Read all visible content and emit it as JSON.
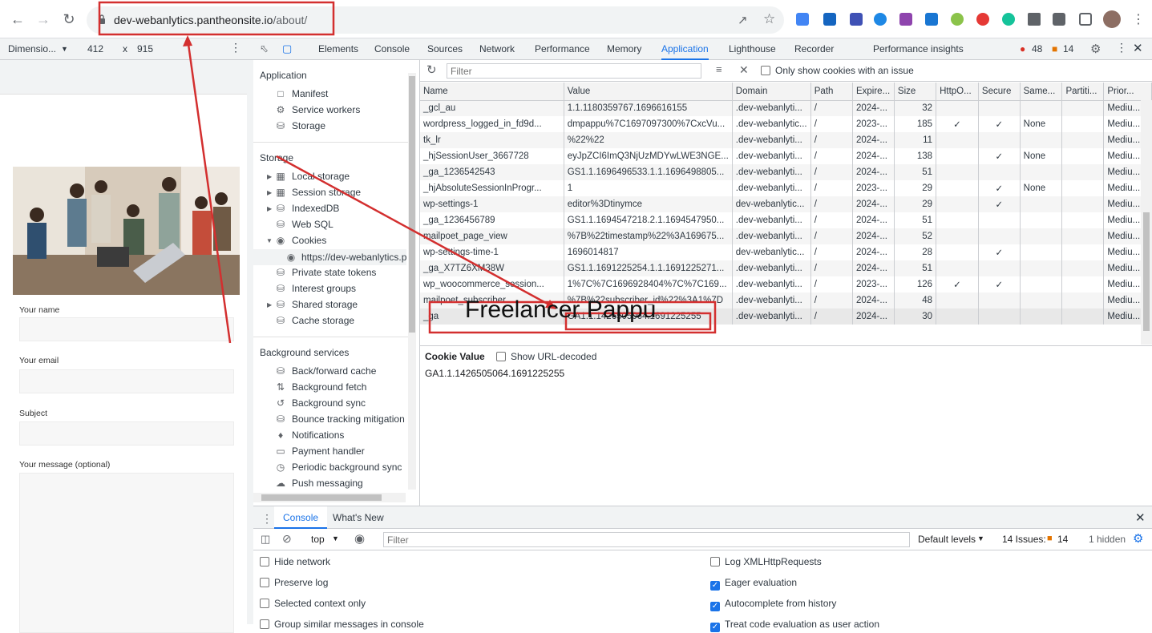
{
  "browser": {
    "url_host": "dev-webanlytics.pantheonsite.io",
    "url_path": "/about/"
  },
  "devtools_top": {
    "device": "Dimensio...",
    "width": "412",
    "times": "x",
    "height": "915",
    "tabs": [
      "Elements",
      "Console",
      "Sources",
      "Network",
      "Performance",
      "Memory",
      "Application",
      "Lighthouse",
      "Recorder",
      "Performance insights"
    ],
    "errors": "48",
    "warnings": "14"
  },
  "page": {
    "labels": {
      "name": "Your name",
      "email": "Your email",
      "subject": "Subject",
      "message": "Your message (optional)"
    }
  },
  "sidebar": {
    "application_header": "Application",
    "application_items": [
      "Manifest",
      "Service workers",
      "Storage"
    ],
    "storage_header": "Storage",
    "storage_items": [
      "Local storage",
      "Session storage",
      "IndexedDB",
      "Web SQL",
      "Cookies",
      "https://dev-webanlytics.p",
      "Private state tokens",
      "Interest groups",
      "Shared storage",
      "Cache storage"
    ],
    "background_header": "Background services",
    "background_items": [
      "Back/forward cache",
      "Background fetch",
      "Background sync",
      "Bounce tracking mitigation",
      "Notifications",
      "Payment handler",
      "Periodic background sync",
      "Push messaging"
    ]
  },
  "cookies": {
    "filter_placeholder": "Filter",
    "only_issues": "Only show cookies with an issue",
    "columns": [
      "Name",
      "Value",
      "Domain",
      "Path",
      "Expire...",
      "Size",
      "HttpO...",
      "Secure",
      "Same...",
      "Partiti...",
      "Prior..."
    ],
    "rows": [
      [
        "_gcl_au",
        "1.1.1180359767.1696616155",
        ".dev-webanlyti...",
        "/",
        "2024-...",
        "32",
        "",
        "",
        "",
        "",
        "Mediu..."
      ],
      [
        "wordpress_logged_in_fd9d...",
        "dmpappu%7C1697097300%7CxcVu...",
        ".dev-webanlytic...",
        "/",
        "2023-...",
        "185",
        "✓",
        "✓",
        "None",
        "",
        "Mediu..."
      ],
      [
        "tk_lr",
        "%22%22",
        ".dev-webanlyti...",
        "/",
        "2024-...",
        "11",
        "",
        "",
        "",
        "",
        "Mediu..."
      ],
      [
        "_hjSessionUser_3667728",
        "eyJpZCI6ImQ3NjUzMDYwLWE3NGE...",
        ".dev-webanlyti...",
        "/",
        "2024-...",
        "138",
        "",
        "✓",
        "None",
        "",
        "Mediu..."
      ],
      [
        "_ga_1236542543",
        "GS1.1.1696496533.1.1.1696498805...",
        ".dev-webanlyti...",
        "/",
        "2024-...",
        "51",
        "",
        "",
        "",
        "",
        "Mediu..."
      ],
      [
        "_hjAbsoluteSessionInProgr...",
        "1",
        ".dev-webanlyti...",
        "/",
        "2023-...",
        "29",
        "",
        "✓",
        "None",
        "",
        "Mediu..."
      ],
      [
        "wp-settings-1",
        "editor%3Dtinymce",
        "dev-webanlytic...",
        "/",
        "2024-...",
        "29",
        "",
        "✓",
        "",
        "",
        "Mediu..."
      ],
      [
        "_ga_1236456789",
        "GS1.1.1694547218.2.1.1694547950...",
        ".dev-webanlyti...",
        "/",
        "2024-...",
        "51",
        "",
        "",
        "",
        "",
        "Mediu..."
      ],
      [
        "mailpoet_page_view",
        "%7B%22timestamp%22%3A169675...",
        ".dev-webanlyti...",
        "/",
        "2024-...",
        "52",
        "",
        "",
        "",
        "",
        "Mediu..."
      ],
      [
        "wp-settings-time-1",
        "1696014817",
        "dev-webanlytic...",
        "/",
        "2024-...",
        "28",
        "",
        "✓",
        "",
        "",
        "Mediu..."
      ],
      [
        "_ga_X7TZ6XM38W",
        "GS1.1.1691225254.1.1.1691225271...",
        ".dev-webanlyti...",
        "/",
        "2024-...",
        "51",
        "",
        "",
        "",
        "",
        "Mediu..."
      ],
      [
        "wp_woocommerce_session...",
        "1%7C%7C1696928404%7C%7C169...",
        ".dev-webanlyti...",
        "/",
        "2023-...",
        "126",
        "✓",
        "✓",
        "",
        "",
        "Mediu..."
      ],
      [
        "mailpoet_subscriber",
        "%7B%22subscriber_id%22%3A1%7D",
        ".dev-webanlyti...",
        "/",
        "2024-...",
        "48",
        "",
        "",
        "",
        "",
        "Mediu..."
      ],
      [
        "_ga",
        "GA1.1.1426505064.1691225255",
        ".dev-webanlyti...",
        "/",
        "2024-...",
        "30",
        "",
        "",
        "",
        "",
        "Mediu..."
      ]
    ],
    "cookie_value_label": "Cookie Value",
    "show_decoded": "Show URL-decoded",
    "selected_value": "GA1.1.1426505064.1691225255"
  },
  "drawer": {
    "tabs": [
      "Console",
      "What's New"
    ],
    "context": "top",
    "filter_placeholder": "Filter",
    "levels": "Default levels",
    "issues_label": "14 Issues:",
    "issues_count": "14",
    "hidden": "1 hidden",
    "options_left": [
      "Hide network",
      "Preserve log",
      "Selected context only",
      "Group similar messages in console"
    ],
    "options_right": [
      "Log XMLHttpRequests",
      "Eager evaluation",
      "Autocomplete from history",
      "Treat code evaluation as user action"
    ],
    "options_right_checked": [
      false,
      true,
      true,
      true
    ]
  },
  "watermark": "Freelancer Pappu",
  "colors": {
    "accent": "#1a73e8",
    "annotation": "#d32f2f"
  }
}
